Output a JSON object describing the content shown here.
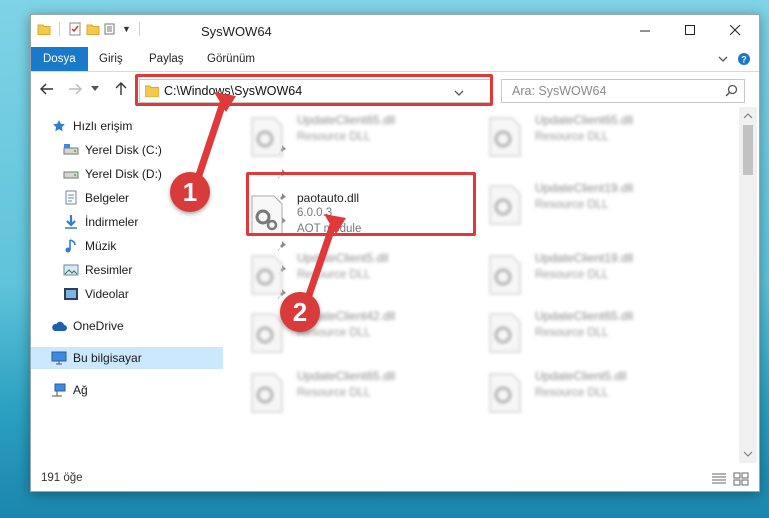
{
  "window": {
    "title": "SysWOW64"
  },
  "ribbon": {
    "tabs": [
      "Dosya",
      "Giriş",
      "Paylaş",
      "Görünüm"
    ]
  },
  "address": {
    "path": "C:\\Windows\\SysWOW64",
    "search_placeholder": "Ara: SysWOW64"
  },
  "sidebar": {
    "items": [
      {
        "label": "Hızlı erişim",
        "icon": "star-icon"
      },
      {
        "label": "Yerel Disk (C:)",
        "icon": "drive-icon"
      },
      {
        "label": "Yerel Disk (D:)",
        "icon": "drive-icon"
      },
      {
        "label": "Belgeler",
        "icon": "documents-icon"
      },
      {
        "label": "İndirmeler",
        "icon": "download-icon"
      },
      {
        "label": "Müzik",
        "icon": "music-icon"
      },
      {
        "label": "Resimler",
        "icon": "pictures-icon"
      },
      {
        "label": "Videolar",
        "icon": "videos-icon"
      },
      {
        "label": "OneDrive",
        "icon": "cloud-icon"
      },
      {
        "label": "Bu bilgisayar",
        "icon": "computer-icon"
      },
      {
        "label": "Ağ",
        "icon": "network-icon"
      }
    ]
  },
  "files": {
    "highlighted": {
      "name": "paotauto.dll",
      "version": "6.0.0.3",
      "description": "AOT module"
    },
    "left_column": [
      {
        "name": "UpdateClient65.dll",
        "desc": "Resource DLL"
      },
      {
        "name": "UpdateClient5.dll",
        "desc": "Resource DLL"
      },
      {
        "name": "UpdateClient42.dll",
        "desc": "Resource DLL"
      },
      {
        "name": "UpdateClient65.dll",
        "desc": "Resource DLL"
      }
    ],
    "right_column": [
      {
        "name": "UpdateClient65.dll",
        "desc": "Resource DLL"
      },
      {
        "name": "UpdateClient19.dll",
        "desc": "Resource DLL"
      },
      {
        "name": "UpdateClient19.dll",
        "desc": "Resource DLL"
      },
      {
        "name": "UpdateClient65.dll",
        "desc": "Resource DLL"
      },
      {
        "name": "UpdateClient5.dll",
        "desc": "Resource DLL"
      }
    ]
  },
  "status": {
    "item_count": "191 öğe"
  },
  "callouts": {
    "first": "1",
    "second": "2"
  },
  "colors": {
    "accent": "#1979ca",
    "callout_red": "#e0393a",
    "selection": "#cce8ff"
  }
}
